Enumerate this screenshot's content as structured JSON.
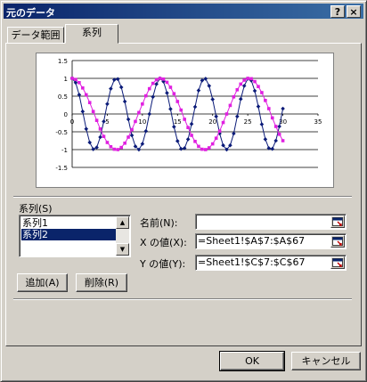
{
  "window": {
    "title": "元のデータ",
    "help_label": "?",
    "close_label": "×"
  },
  "tabs": [
    {
      "label": "データ範囲",
      "active": false
    },
    {
      "label": "系列",
      "active": true
    }
  ],
  "series_section": {
    "label": "系列(S)",
    "items": [
      "系列1",
      "系列2"
    ],
    "selected": "系列2"
  },
  "fields": {
    "name_label": "名前(N):",
    "name_value": "",
    "x_label": "X の値(X):",
    "x_value": "=Sheet1!$A$7:$A$67",
    "y_label": "Y の値(Y):",
    "y_value": "=Sheet1!$C$7:$C$67"
  },
  "buttons": {
    "add": "追加(A)",
    "delete": "削除(R)",
    "ok": "OK",
    "cancel": "キャンセル"
  },
  "colors": {
    "series1": "#0a1a78",
    "series2": "#e020e0",
    "title_bar": "#0a246a",
    "selection": "#0a246a"
  },
  "chart_data": {
    "type": "scatter",
    "title": "",
    "xlim": [
      0,
      35
    ],
    "ylim": [
      -1.5,
      1.5
    ],
    "x_ticks": [
      "0",
      "5",
      "10",
      "15",
      "20",
      "25",
      "30",
      "35"
    ],
    "y_ticks": [
      "1.5",
      "1",
      "0.5",
      "0",
      "-0.5",
      "-1",
      "-1.5"
    ],
    "grid": "horizontal",
    "legend": "none",
    "series": [
      {
        "color": "#0a1a78",
        "marker": "diamond",
        "x": [
          0,
          0.5,
          1,
          1.5,
          2,
          2.5,
          3,
          3.5,
          4,
          4.5,
          5,
          5.5,
          6,
          6.5,
          7,
          7.5,
          8,
          8.5,
          9,
          9.5,
          10,
          10.5,
          11,
          11.5,
          12,
          12.5,
          13,
          13.5,
          14,
          14.5,
          15,
          15.5,
          16,
          16.5,
          17,
          17.5,
          18,
          18.5,
          19,
          19.5,
          20,
          20.5,
          21,
          21.5,
          22,
          22.5,
          23,
          23.5,
          24,
          24.5,
          25,
          25.5,
          26,
          26.5,
          27,
          27.5,
          28,
          28.5,
          29,
          29.5,
          30
        ],
        "y": [
          1.0,
          0.88,
          0.54,
          0.07,
          -0.42,
          -0.8,
          -0.99,
          -0.94,
          -0.65,
          -0.21,
          0.28,
          0.71,
          0.96,
          0.98,
          0.75,
          0.35,
          -0.15,
          -0.6,
          -0.91,
          -1.0,
          -0.84,
          -0.48,
          0.0,
          0.48,
          0.84,
          1.0,
          0.91,
          0.59,
          0.14,
          -0.36,
          -0.76,
          -0.98,
          -0.96,
          -0.71,
          -0.28,
          0.2,
          0.66,
          0.94,
          0.99,
          0.79,
          0.41,
          -0.07,
          -0.55,
          -0.88,
          -1.0,
          -0.88,
          -0.55,
          -0.07,
          0.42,
          0.79,
          0.99,
          0.94,
          0.65,
          0.21,
          -0.29,
          -0.71,
          -0.96,
          -0.98,
          -0.75,
          -0.35,
          0.15
        ]
      },
      {
        "color": "#e020e0",
        "marker": "square",
        "x": [
          0,
          0.5,
          1,
          1.5,
          2,
          2.5,
          3,
          3.5,
          4,
          4.5,
          5,
          5.5,
          6,
          6.5,
          7,
          7.5,
          8,
          8.5,
          9,
          9.5,
          10,
          10.5,
          11,
          11.5,
          12,
          12.5,
          13,
          13.5,
          14,
          14.5,
          15,
          15.5,
          16,
          16.5,
          17,
          17.5,
          18,
          18.5,
          19,
          19.5,
          20,
          20.5,
          21,
          21.5,
          22,
          22.5,
          23,
          23.5,
          24,
          24.5,
          25,
          25.5,
          26,
          26.5,
          27,
          27.5,
          28,
          28.5,
          29,
          29.5,
          30
        ],
        "y": [
          1.0,
          0.97,
          0.88,
          0.73,
          0.54,
          0.32,
          0.07,
          -0.18,
          -0.42,
          -0.63,
          -0.8,
          -0.92,
          -0.99,
          -1.0,
          -0.94,
          -0.82,
          -0.65,
          -0.44,
          -0.21,
          0.04,
          0.28,
          0.51,
          0.71,
          0.86,
          0.96,
          1.0,
          0.98,
          0.89,
          0.75,
          0.57,
          0.35,
          0.11,
          -0.15,
          -0.38,
          -0.6,
          -0.77,
          -0.91,
          -0.99,
          -1.0,
          -0.95,
          -0.84,
          -0.68,
          -0.48,
          -0.24,
          0.0,
          0.24,
          0.48,
          0.68,
          0.84,
          0.95,
          1.0,
          0.99,
          0.91,
          0.77,
          0.6,
          0.38,
          0.15,
          -0.11,
          -0.35,
          -0.57,
          -0.75
        ]
      }
    ]
  }
}
